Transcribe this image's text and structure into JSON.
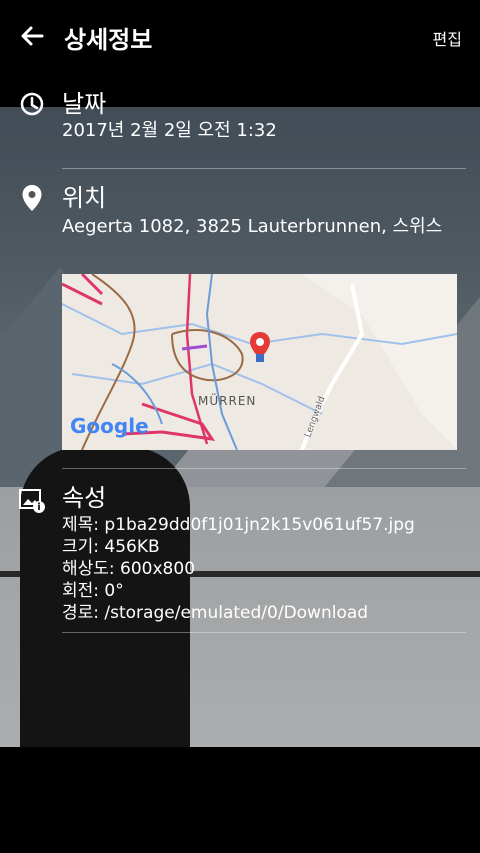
{
  "header": {
    "title": "상세정보",
    "edit_label": "편집"
  },
  "date_section": {
    "title": "날짜",
    "value": "2017년 2월 2일 오전 1:32"
  },
  "location_section": {
    "title": "위치",
    "address": "Aegerta 1082, 3825 Lauterbrunnen, 스위스",
    "map_label": "MÜRREN",
    "map_road_label": "Lengwald",
    "map_logo": "Google"
  },
  "properties_section": {
    "title": "속성",
    "title_line": "제목: p1ba29dd0f1j01jn2k15v061uf57.jpg",
    "size_line": "크기: 456KB",
    "resolution_line": "해상도: 600x800",
    "rotation_line": "회전: 0°",
    "path_line": "경로: /storage/emulated/0/Download"
  },
  "colors": {
    "map_pin": "#e53935",
    "map_route_red": "#e0356b",
    "map_route_blue": "#6b9bd8",
    "map_route_brown": "#9b6b45"
  }
}
